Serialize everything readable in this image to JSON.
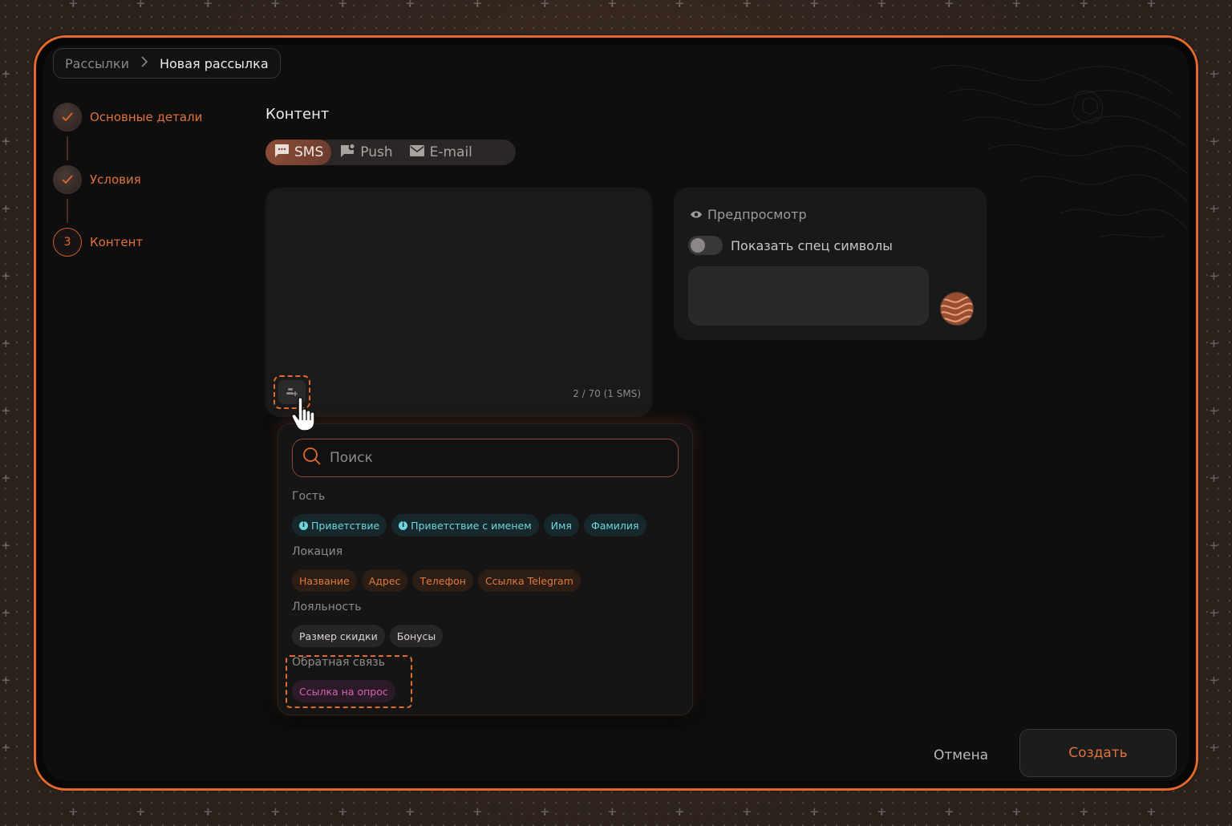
{
  "breadcrumb": {
    "parent": "Рассылки",
    "current": "Новая рассылка"
  },
  "steps": [
    {
      "label": "Основные детали",
      "status": "done"
    },
    {
      "label": "Условия",
      "status": "done"
    },
    {
      "label": "Контент",
      "status": "active",
      "number": "3"
    }
  ],
  "content": {
    "title": "Контент",
    "tabs": [
      {
        "label": "SMS",
        "icon": "sms-icon",
        "active": true
      },
      {
        "label": "Push",
        "icon": "push-icon",
        "active": false
      },
      {
        "label": "E-mail",
        "icon": "email-icon",
        "active": false
      }
    ],
    "counter": "2 / 70 (1 SMS)"
  },
  "preview": {
    "title": "Предпросмотр",
    "toggle_label": "Показать спец символы",
    "toggle_on": false
  },
  "variables": {
    "search_placeholder": "Поиск",
    "groups": [
      {
        "title": "Гость",
        "color": "cyan",
        "chips": [
          "Приветствие",
          "Приветствие с именем",
          "Имя",
          "Фамилия"
        ]
      },
      {
        "title": "Локация",
        "color": "orange",
        "chips": [
          "Название",
          "Адрес",
          "Телефон",
          "Ссылка Telegram"
        ]
      },
      {
        "title": "Лояльность",
        "color": "gray",
        "chips": [
          "Размер скидки",
          "Бонусы"
        ]
      },
      {
        "title": "Обратная связь",
        "color": "pink",
        "chips": [
          "Ссылка на опрос"
        ]
      }
    ]
  },
  "actions": {
    "cancel": "Отмена",
    "create": "Создать"
  },
  "colors": {
    "accent": "#e26a2c",
    "background": "#0e0e0e",
    "cyan_chip": "#6fd6de",
    "pink_chip": "#d562b2"
  }
}
